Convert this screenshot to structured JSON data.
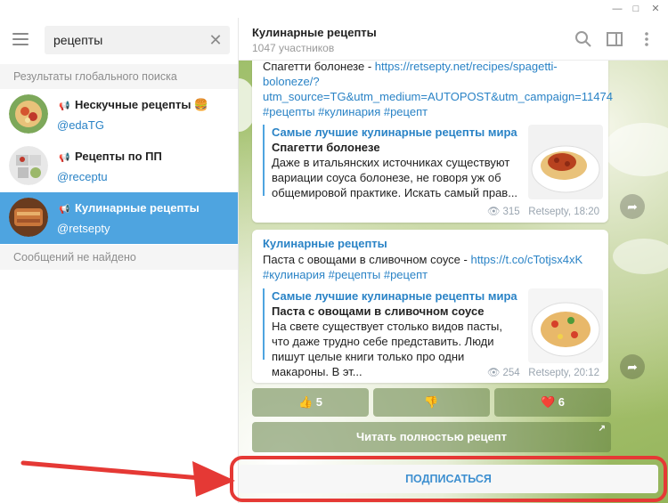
{
  "window": {
    "minimize": "—",
    "maximize": "□",
    "close": "✕"
  },
  "search": {
    "value": "рецепты"
  },
  "left": {
    "global_results_label": "Результаты глобального поиска",
    "no_messages_label": "Сообщений не найдено",
    "results": [
      {
        "name": "Нескучные рецепты",
        "emoji": "🍔",
        "handle": "@edaTG"
      },
      {
        "name": "Рецепты по ПП",
        "handle": "@receptu"
      },
      {
        "name": "Кулинарные рецепты",
        "handle": "@retsepty"
      }
    ]
  },
  "chat": {
    "title": "Кулинарные рецепты",
    "subtitle": "1047 участников",
    "message1": {
      "text_prefix": "Спагетти болонезе - ",
      "link": "https://retsepty.net/recipes/spagetti-boloneze/?utm_source=TG&utm_medium=AUTOPOST&utm_campaign=11474",
      "link_line1": "https://retsepty.net/recipes/spagetti-",
      "link_line2": "boloneze/?",
      "link_line3": "utm_source=TG&utm_medium=AUTOPOST&utm_campaign=11474",
      "tags": "#рецепты #кулинария #рецепт",
      "preview_site": "Самые лучшие кулинарные рецепты мира",
      "preview_title": "Спагетти болонезе",
      "preview_desc": "Даже в итальянских источниках существуют вариации соуса болонезе, не говоря уж об общемировой практике. Искать самый прав...",
      "views": "315",
      "author_time": "Retsepty, 18:20"
    },
    "message2": {
      "channel": "Кулинарные рецепты",
      "text_prefix": "Паста с овощами в сливочном соусе - ",
      "link": "https://t.co/cTotjsx4xK",
      "tags": "#кулинария #рецепты #рецепт",
      "preview_site": "Самые лучшие кулинарные рецепты мира",
      "preview_title": "Паста с овощами в сливочном соусе",
      "preview_desc": "На свете существует столько видов пасты, что даже трудно себе представить. Люди пишут целые книги только про одни макароны. В эт...",
      "views": "254",
      "author_time": "Retsepty, 20:12"
    },
    "reactions": [
      {
        "emoji": "👍",
        "count": "5"
      },
      {
        "emoji": "👎",
        "count": ""
      },
      {
        "emoji": "❤️",
        "count": "6"
      }
    ],
    "read_full": "Читать полностью рецепт",
    "subscribe": "ПОДПИСАТЬСЯ"
  },
  "colors": {
    "accent": "#4ea4e0",
    "link": "#2a83c6",
    "highlight": "#e53935"
  },
  "icons": [
    "menu-icon",
    "close-icon",
    "megaphone-icon",
    "search-icon",
    "sidebar-icon",
    "more-icon",
    "eye-icon",
    "share-icon"
  ]
}
